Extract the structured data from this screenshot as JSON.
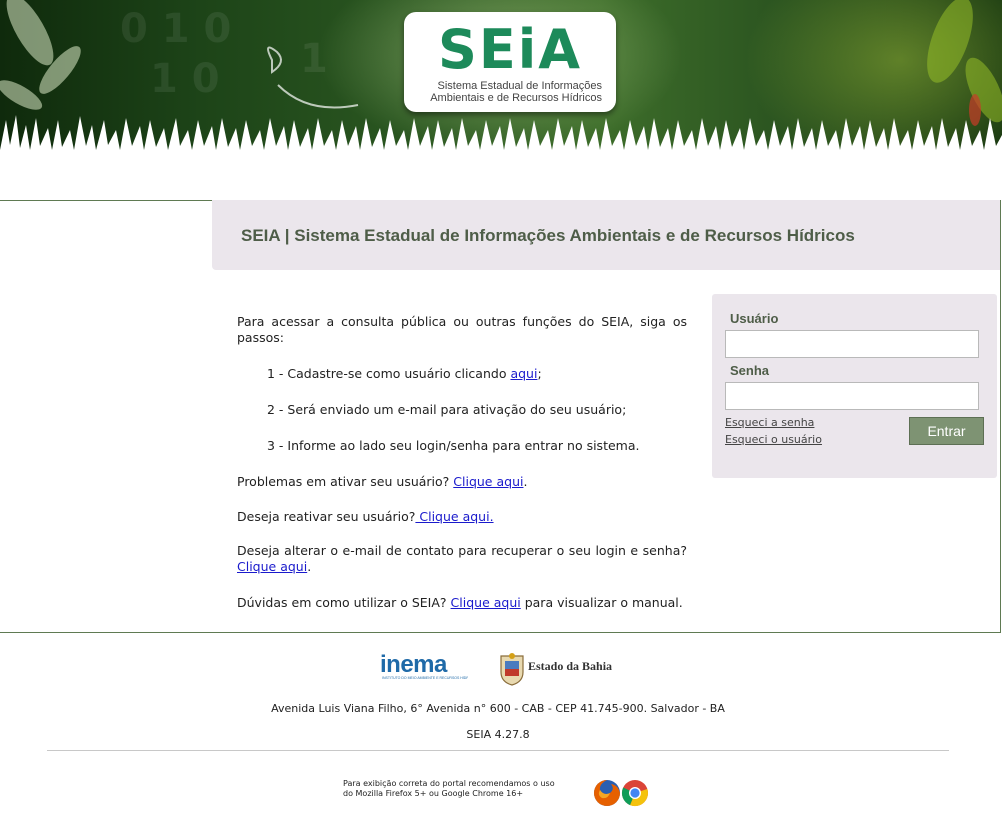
{
  "header": {
    "logo_word": "SEiA",
    "logo_sub_line1": "Sistema Estadual de Informações",
    "logo_sub_line2": "Ambientais e de Recursos Hídricos"
  },
  "title": "SEIA | Sistema Estadual de Informações Ambientais e de Recursos Hídricos",
  "instructions": {
    "intro": "Para acessar a consulta pública ou outras funções do SEIA, siga os passos:",
    "step1_text": "1 - Cadastre-se como usuário clicando ",
    "step1_link": "aqui",
    "step1_end": ";",
    "step2": "2 - Será enviado um e-mail para ativação do seu usuário;",
    "step3": "3 - Informe ao lado seu login/senha para entrar no sistema.",
    "problem_text": "Problemas em ativar seu usuário? ",
    "problem_link": "Clique aqui",
    "problem_end": ".",
    "reactivate_text": "Deseja reativar seu usuário?",
    "reactivate_link": " Clique aqui.",
    "email_text": "Deseja alterar o e-mail de contato para recuperar o seu login e senha? ",
    "email_link": "Clique aqui",
    "email_end": ".",
    "manual_text": "Dúvidas em como utilizar o SEIA? ",
    "manual_link": "Clique aqui",
    "manual_end": " para visualizar o manual."
  },
  "login": {
    "user_label": "Usuário",
    "user_value": "",
    "password_label": "Senha",
    "password_value": "",
    "forgot_password": "Esqueci a senha",
    "forgot_user": "Esqueci o usuário",
    "submit_label": "Entrar",
    "button_color": "#7e9373"
  },
  "footer": {
    "inema_logo": "inema",
    "inema_tagline": "INSTITUTO DO MEIO AMBIENTE E RECURSOS HÍDRICOS",
    "bahia_logo": "Estado da Bahia",
    "address": "Avenida Luis Viana Filho, 6° Avenida n° 600 - CAB - CEP 41.745-900. Salvador - BA",
    "version": "SEIA 4.27.8",
    "browser_note_line1": "Para exibição correta do portal recomendamos o uso",
    "browser_note_line2": "do Mozilla Firefox 5+ ou Google Chrome 16+",
    "icons": [
      "firefox-icon",
      "chrome-icon"
    ]
  },
  "colors": {
    "brand_green": "#1d8a5a",
    "title_text": "#4e5d48",
    "panel_bg": "#ebe6ec",
    "link": "#1a1acc"
  }
}
